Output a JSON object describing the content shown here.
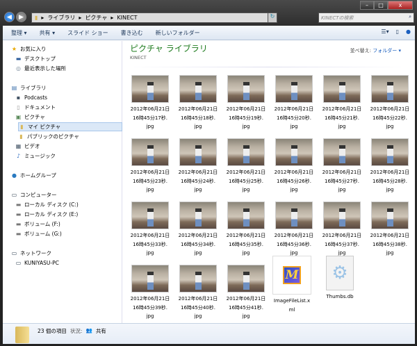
{
  "window": {
    "minimize": "–",
    "maximize": "□",
    "close": "x"
  },
  "address": {
    "crumbs": [
      "ライブラリ",
      "ピクチャ",
      "KINECT"
    ],
    "search_placeholder": "KINECTの検索"
  },
  "toolbar": {
    "organize": "整理 ▾",
    "share": "共有 ▾",
    "slideshow": "スライド ショー",
    "burn": "書き込む",
    "new_folder": "新しいフォルダー"
  },
  "sidebar": {
    "favorites": "お気に入り",
    "desktop": "デスクトップ",
    "recent": "最近表示した場所",
    "libraries": "ライブラリ",
    "podcasts": "Podcasts",
    "documents": "ドキュメント",
    "pictures": "ピクチャ",
    "my_pictures": "マイ ピクチャ",
    "public_pictures": "パブリックのピクチャ",
    "videos": "ビデオ",
    "music": "ミュージック",
    "homegroup": "ホームグループ",
    "computer": "コンピューター",
    "disk_c": "ローカル ディスク (C:)",
    "disk_e": "ローカル ディスク (E:)",
    "vol_f": "ボリューム (F:)",
    "vol_g": "ボリューム (G:)",
    "network": "ネットワーク",
    "pc": "KUNIYASU-PC"
  },
  "content": {
    "title": "ピクチャ ライブラリ",
    "subtitle": "KINECT",
    "sort_label": "並べ替え:",
    "sort_value": "フォルダー ▾",
    "files": [
      {
        "l1": "2012年06月21日",
        "l2": "16時45分17秒.",
        "l3": "jpg"
      },
      {
        "l1": "2012年06月21日",
        "l2": "16時45分18秒.",
        "l3": "jpg"
      },
      {
        "l1": "2012年06月21日",
        "l2": "16時45分19秒.",
        "l3": "jpg"
      },
      {
        "l1": "2012年06月21日",
        "l2": "16時45分20秒.",
        "l3": "jpg"
      },
      {
        "l1": "2012年06月21日",
        "l2": "16時45分21秒.",
        "l3": "jpg"
      },
      {
        "l1": "2012年06月21日",
        "l2": "16時45分22秒.",
        "l3": "jpg"
      },
      {
        "l1": "2012年06月21日",
        "l2": "16時45分23秒.",
        "l3": "jpg"
      },
      {
        "l1": "2012年06月21日",
        "l2": "16時45分24秒.",
        "l3": "jpg"
      },
      {
        "l1": "2012年06月21日",
        "l2": "16時45分25秒.",
        "l3": "jpg"
      },
      {
        "l1": "2012年06月21日",
        "l2": "16時45分26秒.",
        "l3": "jpg"
      },
      {
        "l1": "2012年06月21日",
        "l2": "16時45分27秒.",
        "l3": "jpg"
      },
      {
        "l1": "2012年06月21日",
        "l2": "16時45分28秒.",
        "l3": "jpg"
      },
      {
        "l1": "2012年06月21日",
        "l2": "16時45分33秒.",
        "l3": "jpg"
      },
      {
        "l1": "2012年06月21日",
        "l2": "16時45分34秒.",
        "l3": "jpg"
      },
      {
        "l1": "2012年06月21日",
        "l2": "16時45分35秒.",
        "l3": "jpg"
      },
      {
        "l1": "2012年06月21日",
        "l2": "16時45分36秒.",
        "l3": "jpg"
      },
      {
        "l1": "2012年06月21日",
        "l2": "16時45分37秒.",
        "l3": "jpg"
      },
      {
        "l1": "2012年06月21日",
        "l2": "16時45分38秒.",
        "l3": "jpg"
      },
      {
        "l1": "2012年06月21日",
        "l2": "16時45分39秒.",
        "l3": "jpg"
      },
      {
        "l1": "2012年06月21日",
        "l2": "16時45分40秒.",
        "l3": "jpg"
      },
      {
        "l1": "2012年06月21日",
        "l2": "16時45分41秒.",
        "l3": "jpg"
      }
    ],
    "xml_file": {
      "l1": "ImageFileList.x",
      "l2": "ml"
    },
    "db_file": {
      "l1": "Thumbs.db"
    }
  },
  "status": {
    "count": "23 個の項目",
    "state_label": "状況:",
    "state_value": "共有"
  }
}
